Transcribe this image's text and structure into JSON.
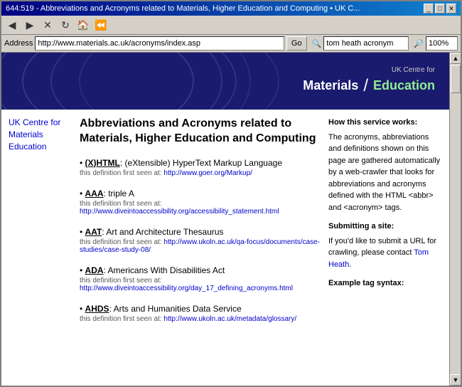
{
  "window": {
    "title": "644:519 - Abbreviations and Acronyms related to Materials, Higher Education and Computing • UK C...",
    "title_bar_buttons": [
      "_",
      "□",
      "✕"
    ]
  },
  "toolbar": {
    "back_label": "◀",
    "forward_label": "▶",
    "stop_label": "✕",
    "refresh_label": "↻",
    "home_label": "🏠",
    "history_label": "⏪"
  },
  "address_bar": {
    "url": "http://www.materials.ac.uk/acronyms/index.asp",
    "go_label": "Go",
    "search_value": "tom heath acronym",
    "zoom_value": "100%"
  },
  "header": {
    "uk_label": "UK Centre for",
    "materials_label": "Materials",
    "divider": "/",
    "education_label": "Education"
  },
  "sidebar_left": {
    "link_text": "UK Centre for Materials Education"
  },
  "article": {
    "title": "Abbreviations and Acronyms related to Materials, Higher Education and Computing",
    "terms": [
      {
        "abbr": "(X)HTML",
        "definition": ": (eXtensible) HyperText Markup Language",
        "source_text": "this definition first seen at: ",
        "source_url": "http://www.goer.org/Markup/"
      },
      {
        "abbr": "AAA",
        "definition": ": triple A",
        "source_text": "this definition first seen at: ",
        "source_url": "http://www.diveintoaccessibility.org/accessibility_statement.html"
      },
      {
        "abbr": "AAT",
        "definition": ": Art and Architecture Thesaurus",
        "source_text": "this definition first seen at: ",
        "source_url": "http://www.ukoln.ac.uk/qa-focus/documents/case-studies/case-study-08/"
      },
      {
        "abbr": "ADA",
        "definition": ": Americans With Disabilities Act",
        "source_text": "this definition first seen at: ",
        "source_url": "http://www.diveintoaccessibility.org/day_17_defining_acronyms.html"
      },
      {
        "abbr": "AHDS",
        "definition": ": Arts and Humanities Data Service",
        "source_text": "this definition first seen at: ",
        "source_url": "http://www.ukoln.ac.uk/metadata/glossary/"
      }
    ]
  },
  "right_sidebar": {
    "how_title": "How this service works:",
    "how_text": "The acronyms, abbreviations and definitions shown on this page are gathered automatically by a web-crawler that looks for abbreviations and acronyms defined with the HTML <abbr> and <acronym> tags.",
    "submit_title": "Submitting a site:",
    "submit_text": "If you'd like to submit a URL for crawling, please contact",
    "submit_link_text": "Tom Heath",
    "submit_text2": ".",
    "example_title": "Example tag syntax:"
  },
  "scrollbar": {
    "up": "▲",
    "down": "▼"
  }
}
